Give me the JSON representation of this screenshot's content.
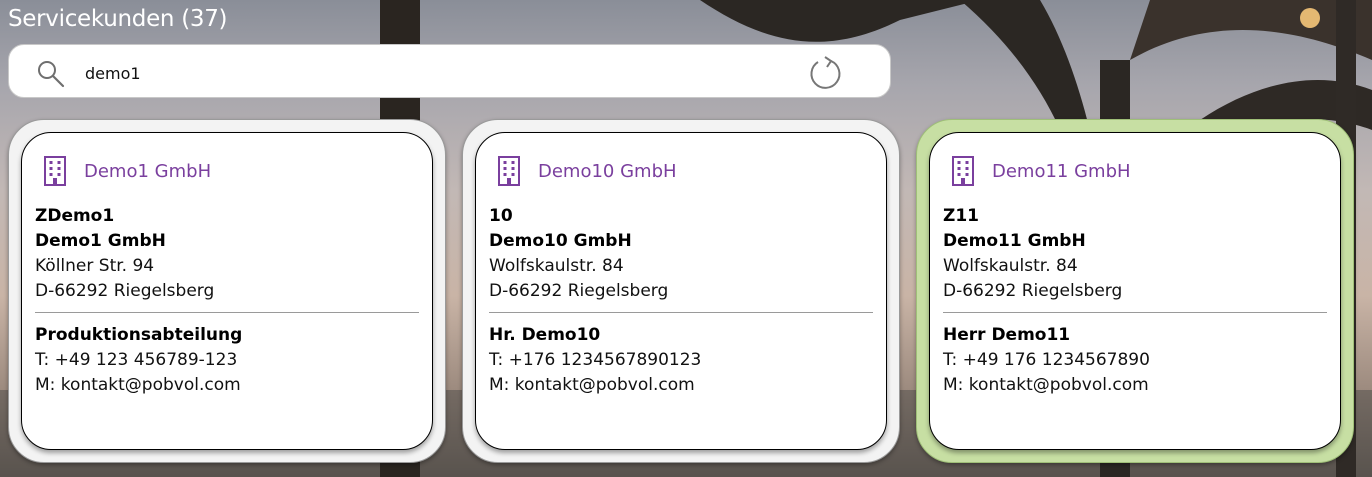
{
  "page": {
    "title": "Servicekunden (37)"
  },
  "search": {
    "value": "demo1"
  },
  "cards": [
    {
      "heading": "Demo1 GmbH",
      "code": "ZDemo1",
      "name": "Demo1 GmbH",
      "street": "Köllner Str. 94",
      "city": "D-66292 Riegelsberg",
      "contact": "Produktionsabteilung",
      "phone": "T: +49 123 456789-123",
      "mail": "M: kontakt@pobvol.com",
      "selected": false
    },
    {
      "heading": "Demo10 GmbH",
      "code": "10",
      "name": "Demo10 GmbH",
      "street": "Wolfskaulstr. 84",
      "city": "D-66292 Riegelsberg",
      "contact": "Hr. Demo10",
      "phone": "T: +176 1234567890123",
      "mail": "M: kontakt@pobvol.com",
      "selected": false
    },
    {
      "heading": "Demo11 GmbH",
      "code": "Z11",
      "name": "Demo11 GmbH",
      "street": "Wolfskaulstr. 84",
      "city": "D-66292 Riegelsberg",
      "contact": "Herr Demo11",
      "phone": "T: +49 176 1234567890",
      "mail": "M: kontakt@pobvol.com",
      "selected": true
    }
  ],
  "colors": {
    "accent": "#7a3f9e",
    "selected_bg": "#c7dfa3"
  },
  "icons": {
    "search": "magnifier-icon",
    "refresh": "refresh-icon",
    "company": "building-icon"
  }
}
